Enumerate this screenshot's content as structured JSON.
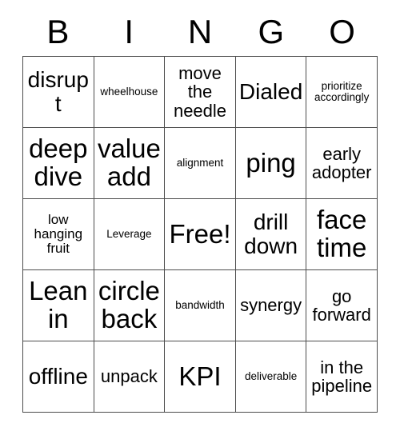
{
  "card": {
    "title": "BINGO",
    "header_letters": [
      "B",
      "I",
      "N",
      "G",
      "O"
    ],
    "free_space_label": "Free!",
    "grid_line_color": "#4d4d4d",
    "background_color": "#ffffff",
    "text_color": "#000000",
    "rows": 5,
    "columns": 5,
    "cells": [
      [
        {
          "text": "disrupt",
          "size": "lg",
          "free": false
        },
        {
          "text": "wheelhouse",
          "size": "xs",
          "free": false
        },
        {
          "text": "move\nthe\nneedle",
          "size": "md",
          "free": false
        },
        {
          "text": "Dialed",
          "size": "lg",
          "free": false
        },
        {
          "text": "prioritize\naccordingly",
          "size": "xs",
          "free": false
        }
      ],
      [
        {
          "text": "deep\ndive",
          "size": "xl",
          "free": false
        },
        {
          "text": "value\nadd",
          "size": "xl",
          "free": false
        },
        {
          "text": "alignment",
          "size": "xs",
          "free": false
        },
        {
          "text": "ping",
          "size": "xl",
          "free": false
        },
        {
          "text": "early\nadopter",
          "size": "md",
          "free": false
        }
      ],
      [
        {
          "text": "low\nhanging\nfruit",
          "size": "sm",
          "free": false
        },
        {
          "text": "Leverage",
          "size": "xs",
          "free": false
        },
        {
          "text": "Free!",
          "size": "xl",
          "free": true
        },
        {
          "text": "drill\ndown",
          "size": "lg",
          "free": false
        },
        {
          "text": "face\ntime",
          "size": "xl",
          "free": false
        }
      ],
      [
        {
          "text": "Lean\nin",
          "size": "xl",
          "free": false
        },
        {
          "text": "circle\nback",
          "size": "xl",
          "free": false
        },
        {
          "text": "bandwidth",
          "size": "xs",
          "free": false
        },
        {
          "text": "synergy",
          "size": "md",
          "free": false
        },
        {
          "text": "go\nforward",
          "size": "md",
          "free": false
        }
      ],
      [
        {
          "text": "offline",
          "size": "lg",
          "free": false
        },
        {
          "text": "unpack",
          "size": "md",
          "free": false
        },
        {
          "text": "KPI",
          "size": "xl",
          "free": false
        },
        {
          "text": "deliverable",
          "size": "xs",
          "free": false
        },
        {
          "text": "in the\npipeline",
          "size": "md",
          "free": false
        }
      ]
    ]
  }
}
